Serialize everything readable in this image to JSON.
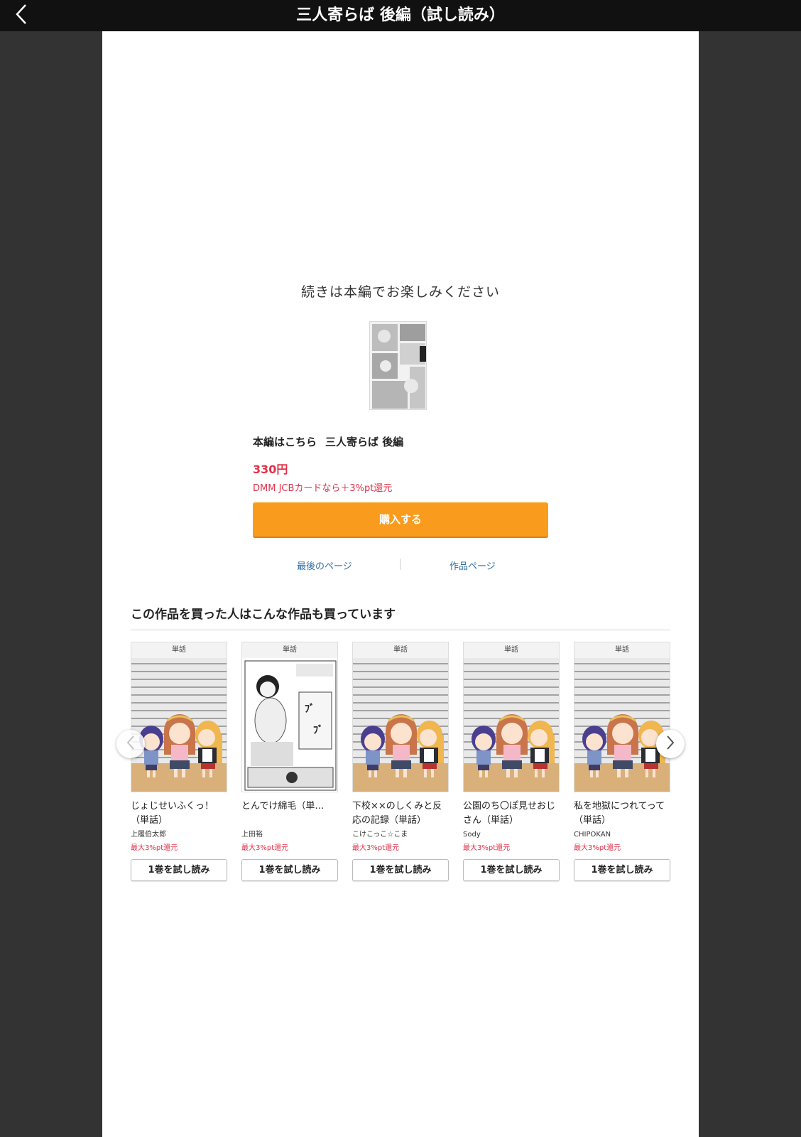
{
  "header": {
    "title": "三人寄らば 後編（試し読み）",
    "back_icon": "chevron-left-icon"
  },
  "end_panel": {
    "message": "続きは本編でお楽しみください",
    "main_label": "本編はこちら",
    "main_title": "三人寄らば 後編",
    "price": "330円",
    "campaign": "DMM JCBカードなら＋3%pt還元",
    "buy_button": "購入する",
    "link_last_page": "最後のページ",
    "link_work_page": "作品ページ"
  },
  "recommend": {
    "heading": "この作品を買った人はこんな作品も買っています",
    "items": [
      {
        "badge": "単話",
        "title": "じょじせいふくっ！（単話）",
        "author": "上履伯太郎",
        "points": "最大3%pt還元",
        "button": "1巻を試し読み"
      },
      {
        "badge": "単話",
        "title": "とんでけ綿毛（単…",
        "author": "上田裕",
        "points": "最大3%pt還元",
        "button": "1巻を試し読み"
      },
      {
        "badge": "単話",
        "title": "下校××のしくみと反応の記録（単話）",
        "author": "こけこっこ☆こま",
        "points": "最大3%pt還元",
        "button": "1巻を試し読み"
      },
      {
        "badge": "単話",
        "title": "公園のち〇ぽ見せおじさん（単話）",
        "author": "Sody",
        "points": "最大3%pt還元",
        "button": "1巻を試し読み"
      },
      {
        "badge": "単話",
        "title": "私を地獄につれてって（単話）",
        "author": "CHIPOKAN",
        "points": "最大3%pt還元",
        "button": "1巻を試し読み"
      }
    ]
  },
  "colors": {
    "accent": "#f99b1c",
    "price": "#e0324b",
    "link": "#2f6ea3",
    "topbar": "#111111",
    "backdrop": "#333333"
  }
}
